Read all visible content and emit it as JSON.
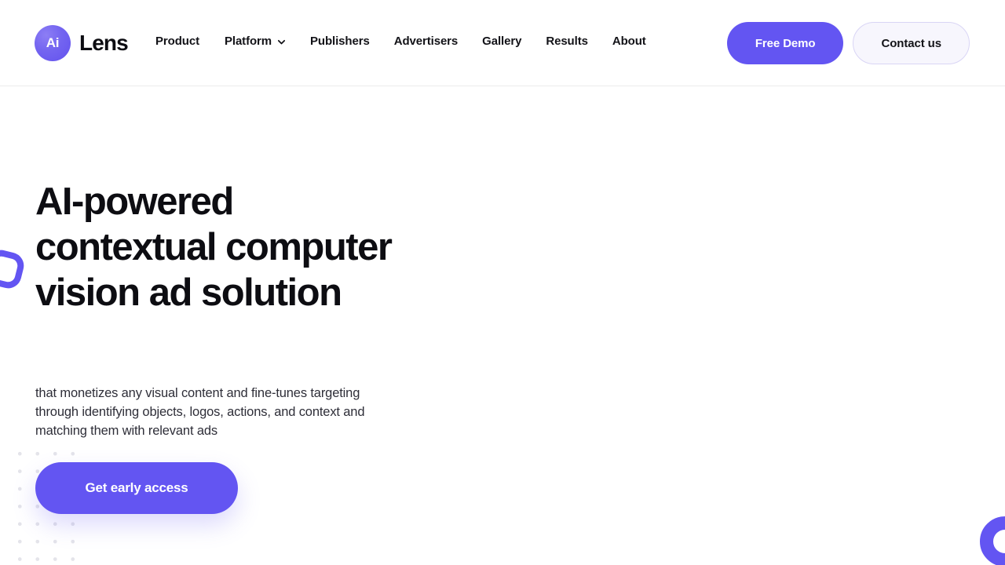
{
  "brand": {
    "mark_text": "Ai",
    "name": "Lens",
    "accent_color": "#6355F2",
    "mark_icon": "brand-logo-circle"
  },
  "nav": {
    "items": [
      {
        "label": "Product",
        "has_dropdown": false
      },
      {
        "label": "Platform",
        "has_dropdown": true,
        "icon": "chevron-down-icon"
      },
      {
        "label": "Publishers",
        "has_dropdown": false
      },
      {
        "label": "Advertisers",
        "has_dropdown": false
      },
      {
        "label": "Gallery",
        "has_dropdown": false
      },
      {
        "label": "Results",
        "has_dropdown": false
      },
      {
        "label": "About",
        "has_dropdown": false
      }
    ]
  },
  "header_actions": {
    "free_demo_label": "Free Demo",
    "contact_label": "Contact us"
  },
  "hero": {
    "headline": "AI-powered contextual computer vision ad solution",
    "subtitle": "that monetizes any visual content and fine-tunes targeting through identifying objects, logos, actions, and context and matching them with relevant ads",
    "cta_label": "Get early access"
  },
  "decorations": {
    "dot_grid": "dot-grid-pattern",
    "left_shape": "rounded-square-ring",
    "corner_shape": "circle-ring",
    "shape_color": "#6355F2",
    "dot_color": "#E4E4EA"
  }
}
